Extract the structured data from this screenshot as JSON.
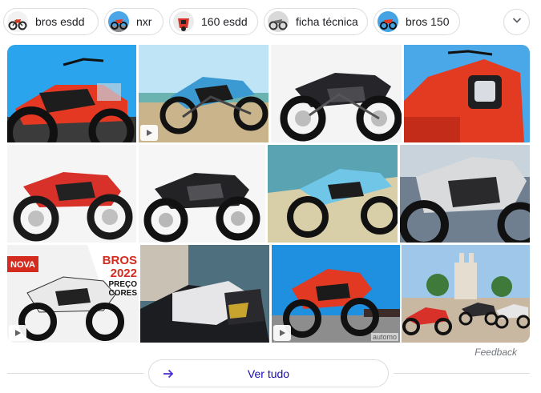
{
  "chips": [
    {
      "label": "bros esdd",
      "thumb": "red-motorcycle"
    },
    {
      "label": "nxr",
      "thumb": "red-motorcycle-blue-sky"
    },
    {
      "label": "160 esdd",
      "thumb": "red-motorcycle-front"
    },
    {
      "label": "ficha técnica",
      "thumb": "gray-motorcycle"
    },
    {
      "label": "bros 150",
      "thumb": "red-motorcycle-blue-sky"
    }
  ],
  "more_chips_icon": "chevron-down-icon",
  "tiles": [
    {
      "subject": "red motorcycle on blue sky",
      "video": false
    },
    {
      "subject": "blue motorcycle on beach",
      "video": true
    },
    {
      "subject": "black motorcycle studio",
      "video": false
    },
    {
      "subject": "red motorcycle front close-up",
      "video": false
    },
    {
      "subject": "red motorcycle studio",
      "video": false
    },
    {
      "subject": "black motorcycle studio",
      "video": false
    },
    {
      "subject": "light blue motorcycle on beach",
      "video": false
    },
    {
      "subject": "gray motorcycle outdoors",
      "video": false
    },
    {
      "subject": "white motorcycle advertisement",
      "video": true,
      "banner_left": "NOVA",
      "banner_right": "BROS",
      "banner_year": "2022",
      "banner_sub": "PREÇO",
      "banner_sub2": "CORES"
    },
    {
      "subject": "white motorcycle detail street",
      "video": false
    },
    {
      "subject": "red motorcycle blue sky",
      "video": true,
      "watermark": "automo"
    },
    {
      "subject": "three motorcycles in town square",
      "video": false
    }
  ],
  "feedback_label": "Feedback",
  "see_all": {
    "label": "Ver tudo",
    "icon": "arrow-right-icon"
  },
  "colors": {
    "link": "#1a0dab",
    "border": "#dadce0",
    "accent_arrow": "#4a2fcf",
    "bike_red": "#e33b22",
    "bike_black": "#1f1f22"
  }
}
